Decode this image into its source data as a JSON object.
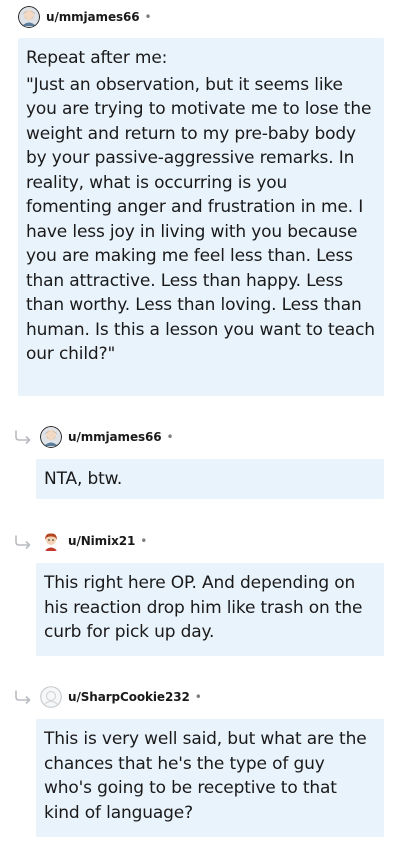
{
  "comments": [
    {
      "username": "u/mmjames66",
      "separator": "•",
      "avatar": "bearded-avatar-icon",
      "body": [
        "Repeat after me:",
        "\"Just an observation, but it seems like you are trying to motivate me to lose the weight and return to my pre-baby body by your passive-aggressive remarks. In reality, what is occurring is you fomenting anger and frustration in me. I have less joy in living with you because you are making me feel less than. Less than attractive. Less than happy. Less than worthy. Less than loving. Less than human. Is this a lesson you want to teach our child?\""
      ]
    },
    {
      "username": "u/mmjames66",
      "separator": "•",
      "avatar": "bearded-avatar-icon",
      "reply_icon": "reply-arrow-icon",
      "body": [
        "NTA, btw."
      ]
    },
    {
      "username": "u/Nimix21",
      "separator": "•",
      "avatar": "red-haired-avatar-icon",
      "reply_icon": "reply-arrow-icon",
      "body": [
        "This right here OP. And depending on his reaction drop him like trash on the curb for pick up day."
      ]
    },
    {
      "username": "u/SharpCookie232",
      "separator": "•",
      "avatar": "default-avatar-icon",
      "reply_icon": "reply-arrow-icon",
      "body": [
        "This is very well said, but what are the chances that he's the type of guy who's going to be receptive to that kind of language?"
      ]
    }
  ],
  "colors": {
    "bubble_bg": "#e9f3fb",
    "text": "#1a1a1b",
    "muted": "#7c7c7c"
  }
}
